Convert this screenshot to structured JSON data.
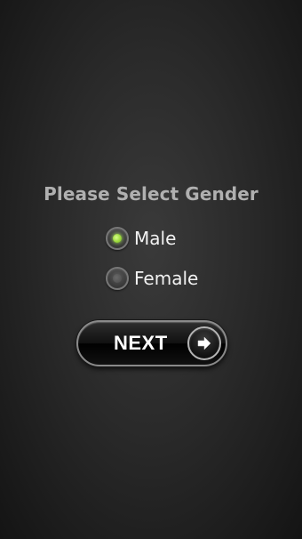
{
  "prompt": {
    "title": "Please Select Gender"
  },
  "gender_options": [
    {
      "label": "Male",
      "selected": true
    },
    {
      "label": "Female",
      "selected": false
    }
  ],
  "next_button": {
    "label": "NEXT",
    "icon": "arrow-right-icon"
  },
  "colors": {
    "selected_dot": "#9cd93c",
    "title_text": "#b0b0b0",
    "option_text": "#f2f2f2"
  }
}
